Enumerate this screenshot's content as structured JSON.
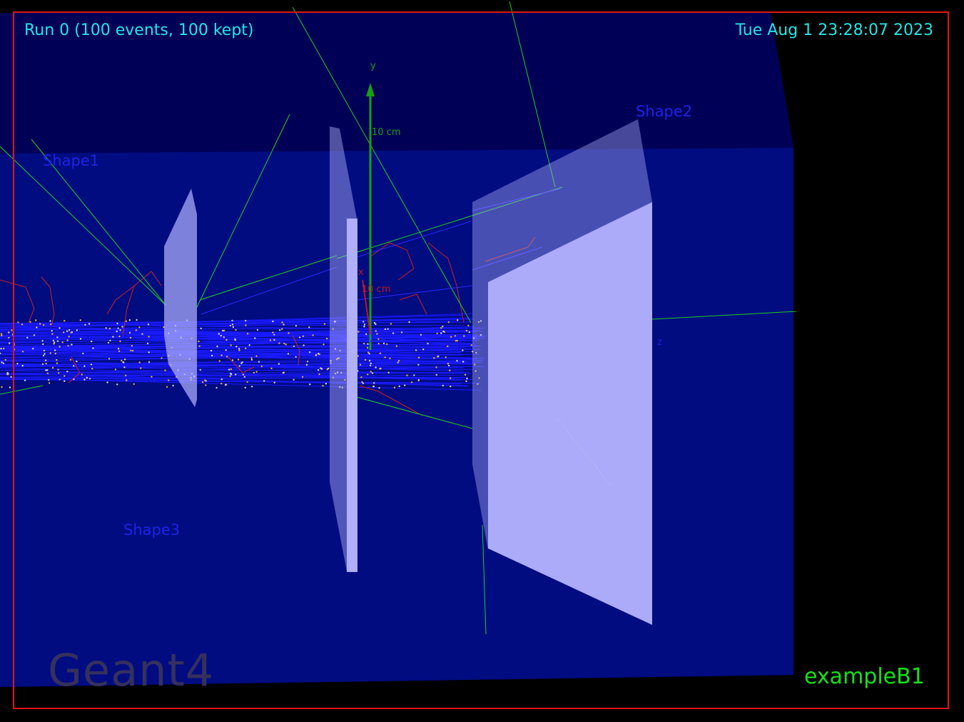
{
  "header": {
    "run_info": "Run 0 (100 events, 100 kept)",
    "timestamp": "Tue Aug  1 23:28:07 2023"
  },
  "footer": {
    "example_name": "exampleB1",
    "logo_text": "Geant4"
  },
  "shapes": {
    "shape1": "Shape1",
    "shape2": "Shape2",
    "shape3": "Shape3"
  },
  "axes": {
    "y_label": "y",
    "y_scale": "10 cm",
    "x_label": "x",
    "x_scale": "10 cm",
    "z_label": "z"
  },
  "colors": {
    "background": "#000000",
    "world_volume": "#000060",
    "envelope_volume": "#000c80",
    "shape_fill": "#b4b4ff",
    "primary_track": "#1a1aff",
    "gamma_track": "#22cc22",
    "electron_track": "#cc2222",
    "step_point": "#e6b43c",
    "frame_border": "#e01616",
    "overlay_text": "#22e6e6",
    "example_text": "#17e017"
  }
}
